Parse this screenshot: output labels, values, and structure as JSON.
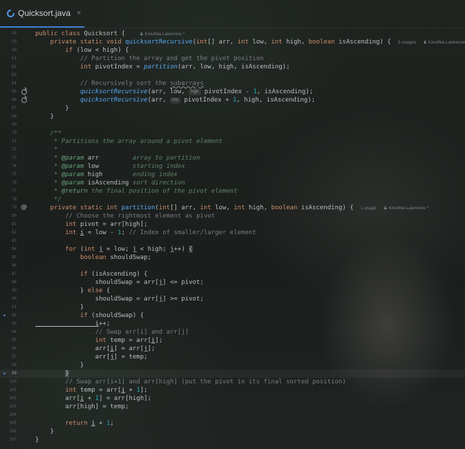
{
  "tab": {
    "filename": "Quicksort.java",
    "close": "×",
    "icon": "java-file-icon",
    "accent": "#3d7fd6"
  },
  "colors": {
    "keyword": "#cf8e6d",
    "method": "#56a8f5",
    "comment": "#7a7e85",
    "doc": "#5f826b",
    "number": "#2aacb8"
  },
  "author": "Kinuthia Lawrence *",
  "lines": [
    {
      "n": "58",
      "segs": [
        [
          "kw",
          "public class "
        ],
        [
          "",
          "Quicksort {  "
        ]
      ],
      "meta": "Kinuthia Lawrence *"
    },
    {
      "n": "59",
      "segs": [
        [
          "kw",
          "    private static void "
        ],
        [
          "fn",
          "quicksortRecursive"
        ],
        [
          "",
          "("
        ],
        [
          "kw",
          "int"
        ],
        [
          "",
          "[] arr, "
        ],
        [
          "kw",
          "int "
        ],
        [
          "",
          "low, "
        ],
        [
          "kw",
          "int "
        ],
        [
          "",
          "high, "
        ],
        [
          "kw",
          "boolean "
        ],
        [
          "",
          "isAscending) {"
        ]
      ],
      "meta2": "3 usages",
      "meta": "Kinuthia Lawrence"
    },
    {
      "n": "60",
      "segs": [
        [
          "kw",
          "        if "
        ],
        [
          "",
          "(low < high) {"
        ]
      ]
    },
    {
      "n": "61",
      "segs": [
        [
          "cm",
          "            // Partition the array and get the pivot position"
        ]
      ]
    },
    {
      "n": "62",
      "segs": [
        [
          "kw",
          "            int "
        ],
        [
          "",
          "pivotIndex = "
        ],
        [
          "it",
          "partition"
        ],
        [
          "",
          "(arr, low, high, isAscending);"
        ]
      ]
    },
    {
      "n": "63",
      "segs": []
    },
    {
      "n": "64",
      "segs": [
        [
          "cm",
          "            // Recursively sort the "
        ],
        [
          "cmsq",
          "subarrays"
        ]
      ]
    },
    {
      "n": "65",
      "gutter": "recurse",
      "segs": [
        [
          "it",
          "            quicksortRecursive"
        ],
        [
          "",
          "(arr, low, "
        ],
        [
          "hint",
          "high"
        ],
        [
          "",
          " pivotIndex - "
        ],
        [
          "num",
          "1"
        ],
        [
          "",
          ", isAscending);"
        ]
      ]
    },
    {
      "n": "66",
      "gutter": "recurse",
      "segs": [
        [
          "it",
          "            quicksortRecursive"
        ],
        [
          "",
          "(arr, "
        ],
        [
          "hint",
          "low"
        ],
        [
          "",
          " pivotIndex + "
        ],
        [
          "num",
          "1"
        ],
        [
          "",
          ", high, isAscending);"
        ]
      ]
    },
    {
      "n": "67",
      "segs": [
        [
          "",
          "        }"
        ]
      ]
    },
    {
      "n": "68",
      "segs": [
        [
          "",
          "    }"
        ]
      ]
    },
    {
      "n": "69",
      "segs": []
    },
    {
      "n": "70",
      "segs": [
        [
          "dc",
          "    /**"
        ]
      ]
    },
    {
      "n": "71",
      "segs": [
        [
          "dc",
          "     * Partitions the array around a pivot element"
        ]
      ]
    },
    {
      "n": "72",
      "segs": [
        [
          "dc",
          "     *"
        ]
      ]
    },
    {
      "n": "73",
      "segs": [
        [
          "dc",
          "     * "
        ],
        [
          "dt",
          "@param "
        ],
        [
          "",
          "arr"
        ],
        [
          "dc",
          "         array to partition"
        ]
      ]
    },
    {
      "n": "74",
      "segs": [
        [
          "dc",
          "     * "
        ],
        [
          "dt",
          "@param "
        ],
        [
          "",
          "low"
        ],
        [
          "dc",
          "         starting index"
        ]
      ]
    },
    {
      "n": "75",
      "segs": [
        [
          "dc",
          "     * "
        ],
        [
          "dt",
          "@param "
        ],
        [
          "",
          "high"
        ],
        [
          "dc",
          "        ending index"
        ]
      ]
    },
    {
      "n": "76",
      "segs": [
        [
          "dc",
          "     * "
        ],
        [
          "dt",
          "@param "
        ],
        [
          "",
          "isAscending"
        ],
        [
          "dc",
          " sort direction"
        ]
      ]
    },
    {
      "n": "77",
      "segs": [
        [
          "dc",
          "     * "
        ],
        [
          "dt",
          "@return "
        ],
        [
          "dc",
          "the final position of the pivot element"
        ]
      ]
    },
    {
      "n": "78",
      "segs": [
        [
          "dc",
          "     */"
        ]
      ]
    },
    {
      "n": "79",
      "gutter": "at",
      "segs": [
        [
          "kw",
          "    private static int "
        ],
        [
          "fn",
          "partition"
        ],
        [
          "",
          "("
        ],
        [
          "kw",
          "int"
        ],
        [
          "",
          "[] arr, "
        ],
        [
          "kw",
          "int "
        ],
        [
          "",
          "low, "
        ],
        [
          "kw",
          "int "
        ],
        [
          "",
          "high, "
        ],
        [
          "kw",
          "boolean "
        ],
        [
          "",
          "isAscending) {"
        ]
      ],
      "meta2": "1 usage",
      "meta": "Kinuthia Lawrence *"
    },
    {
      "n": "80",
      "segs": [
        [
          "cm",
          "        // Choose the rightmost element as pivot"
        ]
      ]
    },
    {
      "n": "81",
      "segs": [
        [
          "kw",
          "        int "
        ],
        [
          "",
          "pivot = arr[high];"
        ]
      ]
    },
    {
      "n": "82",
      "segs": [
        [
          "kw",
          "        int "
        ],
        [
          "ul",
          "i"
        ],
        [
          "",
          " = low - "
        ],
        [
          "num",
          "1"
        ],
        [
          "",
          "; "
        ],
        [
          "cm",
          "// Index of smaller/larger element"
        ]
      ]
    },
    {
      "n": "83",
      "segs": []
    },
    {
      "n": "84",
      "segs": [
        [
          "kw",
          "        for "
        ],
        [
          "",
          "("
        ],
        [
          "kw",
          "int "
        ],
        [
          "ul",
          "j"
        ],
        [
          "",
          " = low; "
        ],
        [
          "ul",
          "j"
        ],
        [
          "",
          " < high; "
        ],
        [
          "ul",
          "j"
        ],
        [
          "",
          "++) "
        ],
        [
          "mb",
          "{"
        ]
      ]
    },
    {
      "n": "85",
      "segs": [
        [
          "kw",
          "            boolean "
        ],
        [
          "",
          "shouldSwap;"
        ]
      ]
    },
    {
      "n": "86",
      "segs": []
    },
    {
      "n": "87",
      "segs": [
        [
          "kw",
          "            if "
        ],
        [
          "",
          "(isAscending) {"
        ]
      ]
    },
    {
      "n": "88",
      "segs": [
        [
          "",
          "                shouldSwap = arr["
        ],
        [
          "ul",
          "j"
        ],
        [
          "",
          "] <= pivot;"
        ]
      ]
    },
    {
      "n": "89",
      "segs": [
        [
          "",
          "            } "
        ],
        [
          "kw",
          "else "
        ],
        [
          "",
          "{"
        ]
      ]
    },
    {
      "n": "90",
      "segs": [
        [
          "",
          "                shouldSwap = arr["
        ],
        [
          "ul",
          "j"
        ],
        [
          "",
          "] >= pivot;"
        ]
      ]
    },
    {
      "n": "91",
      "segs": [
        [
          "",
          "            }"
        ]
      ]
    },
    {
      "n": "92",
      "segs": [
        [
          "kw",
          "            if "
        ],
        [
          "",
          "(shouldSwap) {"
        ]
      ]
    },
    {
      "n": "93",
      "segs": [
        [
          "ul",
          "                i"
        ],
        [
          "",
          "++;"
        ]
      ]
    },
    {
      "n": "94",
      "segs": [
        [
          "cm",
          "                // Swap arr[i] and arr[j]"
        ]
      ]
    },
    {
      "n": "95",
      "segs": [
        [
          "kw",
          "                int "
        ],
        [
          "",
          "temp = arr["
        ],
        [
          "ul",
          "i"
        ],
        [
          "",
          "];"
        ]
      ]
    },
    {
      "n": "96",
      "segs": [
        [
          "",
          "                arr["
        ],
        [
          "ul",
          "i"
        ],
        [
          "",
          "] = arr["
        ],
        [
          "ul",
          "j"
        ],
        [
          "",
          "];"
        ]
      ]
    },
    {
      "n": "97",
      "segs": [
        [
          "",
          "                arr["
        ],
        [
          "ul",
          "j"
        ],
        [
          "",
          "] = temp;"
        ]
      ]
    },
    {
      "n": "98",
      "segs": [
        [
          "",
          "            }"
        ]
      ]
    },
    {
      "n": "99",
      "current": true,
      "segs": [
        [
          "",
          "        "
        ],
        [
          "mb",
          "}"
        ]
      ]
    },
    {
      "n": "100",
      "segs": [
        [
          "cm",
          "        // Swap arr[i+1] and arr[high] (put the pivot in its final sorted position)"
        ]
      ]
    },
    {
      "n": "101",
      "segs": [
        [
          "kw",
          "        int "
        ],
        [
          "",
          "temp = arr["
        ],
        [
          "ul",
          "i"
        ],
        [
          "",
          " + "
        ],
        [
          "num",
          "1"
        ],
        [
          "",
          "];"
        ]
      ]
    },
    {
      "n": "102",
      "segs": [
        [
          "",
          "        arr["
        ],
        [
          "ul",
          "i"
        ],
        [
          "",
          " + "
        ],
        [
          "num",
          "1"
        ],
        [
          "",
          "] = arr[high];"
        ]
      ]
    },
    {
      "n": "103",
      "segs": [
        [
          "",
          "        arr[high] = temp;"
        ]
      ]
    },
    {
      "n": "104",
      "segs": []
    },
    {
      "n": "105",
      "segs": [
        [
          "kw",
          "        return "
        ],
        [
          "ul",
          "i"
        ],
        [
          "",
          " + "
        ],
        [
          "num",
          "1"
        ],
        [
          "",
          ";"
        ]
      ]
    },
    {
      "n": "106",
      "segs": [
        [
          "",
          "    }"
        ]
      ]
    },
    {
      "n": "107",
      "segs": [
        [
          "",
          "}"
        ]
      ]
    }
  ]
}
